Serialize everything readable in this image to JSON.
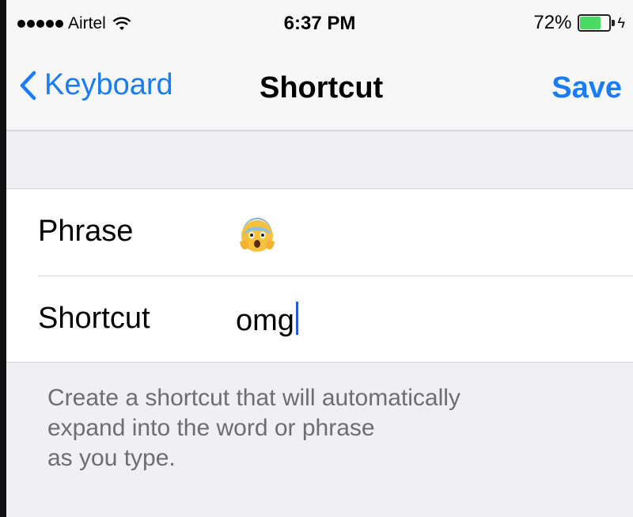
{
  "status_bar": {
    "carrier": "Airtel",
    "time": "6:37 PM",
    "battery_percent": "72%",
    "battery_level": 0.72,
    "signal_dots": 5
  },
  "nav": {
    "back_label": "Keyboard",
    "title": "Shortcut",
    "save_label": "Save"
  },
  "form": {
    "phrase_label": "Phrase",
    "phrase_value_icon": "face-screaming-in-fear-emoji",
    "shortcut_label": "Shortcut",
    "shortcut_value": "omg"
  },
  "footer_note": "Create a shortcut that will automatically\n expand into the word or phrase\nas you type.",
  "colors": {
    "accent": "#1a7cf5",
    "battery": "#4cd964",
    "background": "#efeff4",
    "caret": "#2a5bd7"
  }
}
